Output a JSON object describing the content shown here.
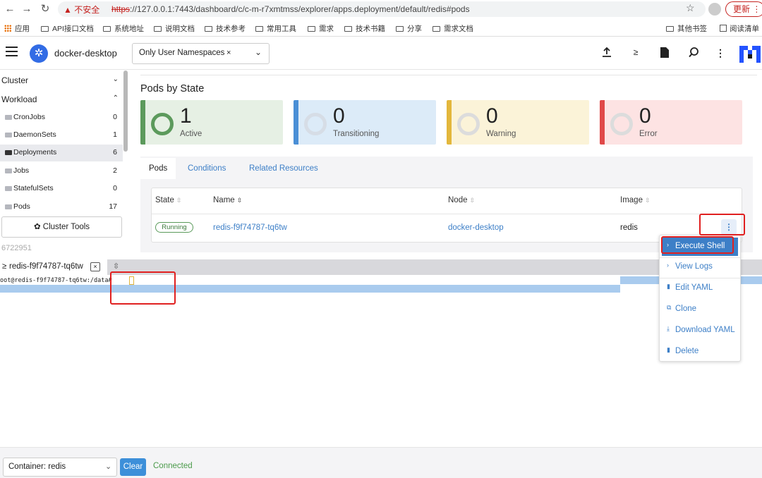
{
  "browser": {
    "back": "←",
    "forward": "→",
    "reload": "↻",
    "security_warning": "▲ 不安全",
    "url_scheme": "https",
    "url_rest": "://127.0.0.1:7443/dashboard/c/c-m-r7xmtmss/explorer/apps.deployment/default/redis#pods",
    "star": "☆",
    "update_button": "更新 ⋮",
    "bookmarks": [
      "应用",
      "API接口文档",
      "系统地址",
      "说明文档",
      "技术参考",
      "常用工具",
      "需求",
      "技术书籍",
      "分享",
      "需求文档"
    ],
    "bookmarks_right": [
      "其他书签",
      "阅读清单"
    ]
  },
  "header": {
    "cluster_name": "docker-desktop",
    "namespace_filter": "Only User Namespaces",
    "namespace_remove": "×",
    "namespace_chevron": "⌄",
    "icons": [
      "upload-icon",
      "shell-icon",
      "file-icon",
      "search-icon",
      "more-vertical-icon"
    ]
  },
  "sidebar": {
    "groups": [
      {
        "label": "Cluster",
        "chevron": "⌄"
      },
      {
        "label": "Workload",
        "chevron": "⌃"
      }
    ],
    "items": [
      {
        "label": "CronJobs",
        "count": "0"
      },
      {
        "label": "DaemonSets",
        "count": "1"
      },
      {
        "label": "Deployments",
        "count": "6",
        "active": true
      },
      {
        "label": "Jobs",
        "count": "2"
      },
      {
        "label": "StatefulSets",
        "count": "0"
      },
      {
        "label": "Pods",
        "count": "17"
      }
    ],
    "cluster_tools": "✿ Cluster Tools",
    "footer_text": "6722951"
  },
  "pods_by_state": {
    "title": "Pods by State",
    "cards": [
      {
        "value": "1",
        "label": "Active",
        "bar": "#5c9a5c",
        "bg": "#e6f0e4",
        "ring": "#5c9a5c"
      },
      {
        "value": "0",
        "label": "Transitioning",
        "bar": "#4a8fd6",
        "bg": "#dcebf8",
        "ring": "#d6dde6"
      },
      {
        "value": "0",
        "label": "Warning",
        "bar": "#e3b73c",
        "bg": "#fbf3d8",
        "ring": "#dcdcdc"
      },
      {
        "value": "0",
        "label": "Error",
        "bar": "#e04848",
        "bg": "#fde3e3",
        "ring": "#dcdcdc"
      }
    ]
  },
  "tabs": [
    {
      "label": "Pods",
      "active": true
    },
    {
      "label": "Conditions",
      "active": false
    },
    {
      "label": "Related Resources",
      "active": false
    }
  ],
  "table": {
    "headers": [
      "State",
      "Name",
      "Node",
      "Image"
    ],
    "sort_icon": "⇳",
    "rows": [
      {
        "state": "Running",
        "name": "redis-f9f74787-tq6tw",
        "node": "docker-desktop",
        "image": "redis"
      }
    ],
    "row_menu": "⋮"
  },
  "action_menu": {
    "items": [
      {
        "icon": "›",
        "label": "Execute Shell",
        "highlighted": true
      },
      {
        "icon": "›",
        "label": "View Logs"
      },
      {
        "icon": "▮",
        "label": "Edit YAML"
      },
      {
        "icon": "⧉",
        "label": "Clone"
      },
      {
        "icon": "⤓",
        "label": "Download YAML"
      },
      {
        "icon": "▮",
        "label": "Delete"
      }
    ]
  },
  "terminal": {
    "tab_icon": "≥",
    "tab_label": "redis-f9f74787-tq6tw",
    "tab_close": "×",
    "resize_icon": "⇳",
    "prompt": "oot@redis-f9f74787-tq6tw:/data#"
  },
  "footer": {
    "container_label": "Container: redis",
    "container_chevron": "⌄",
    "clear": "Clear",
    "status": "Connected",
    "status_color": "#4a9a4a"
  },
  "colors": {
    "accent": "#3d7fc7",
    "annotation_red": "#e02020"
  }
}
